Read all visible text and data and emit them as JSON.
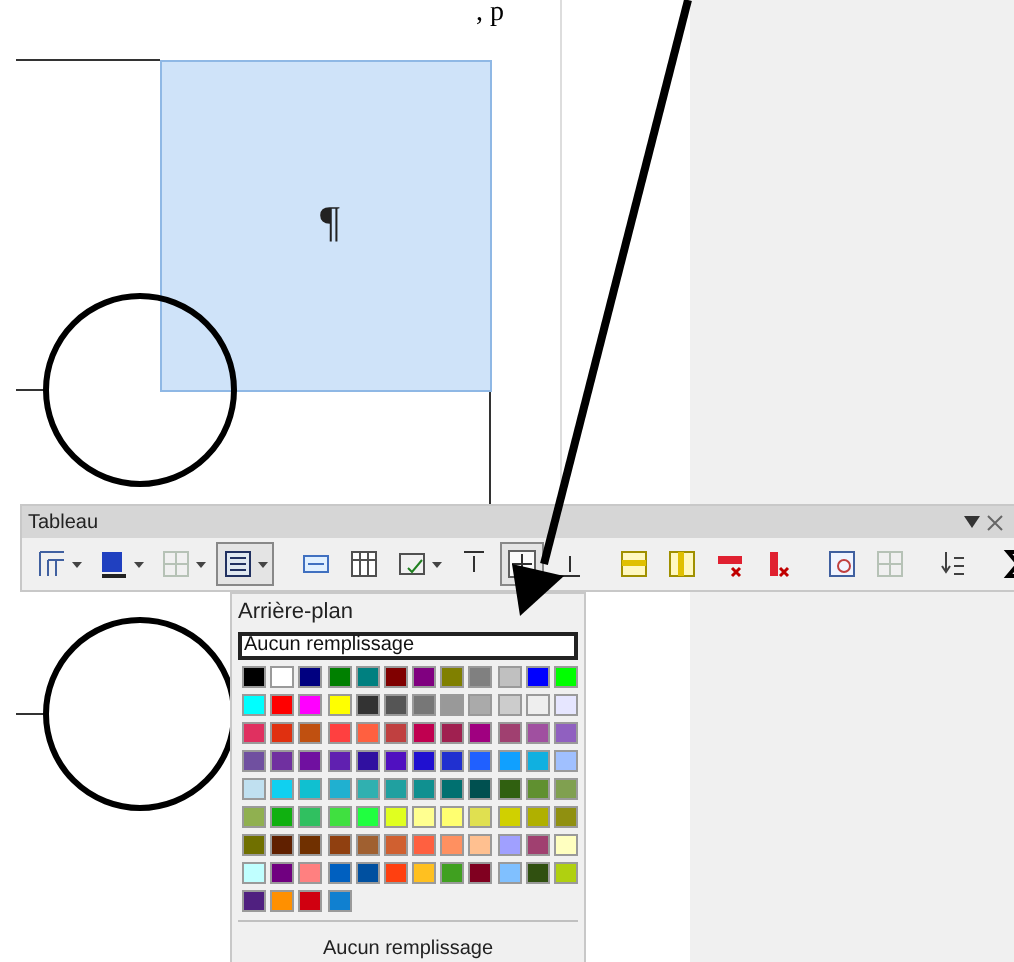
{
  "document": {
    "top_text": ", p",
    "paragraph_mark": "¶"
  },
  "toolbar": {
    "title": "Tableau",
    "buttons": [
      {
        "kind": "borders",
        "pressed": false,
        "dropdown": true
      },
      {
        "kind": "border-style",
        "pressed": false,
        "dropdown": true
      },
      {
        "kind": "merge",
        "pressed": false,
        "dropdown": true,
        "disabled": true
      },
      {
        "kind": "background",
        "pressed": true,
        "dropdown": true
      },
      {
        "kind": "sep"
      },
      {
        "kind": "split-row",
        "pressed": false,
        "dropdown": false
      },
      {
        "kind": "table",
        "pressed": false,
        "dropdown": false
      },
      {
        "kind": "autoformat",
        "pressed": false,
        "dropdown": true
      },
      {
        "kind": "align-top",
        "pressed": false,
        "dropdown": false
      },
      {
        "kind": "align-middle",
        "pressed": true,
        "dropdown": false
      },
      {
        "kind": "align-bottom",
        "pressed": false,
        "dropdown": false
      },
      {
        "kind": "sep"
      },
      {
        "kind": "insert-row",
        "pressed": false,
        "dropdown": false
      },
      {
        "kind": "insert-col",
        "pressed": false,
        "dropdown": false
      },
      {
        "kind": "delete-row",
        "pressed": false,
        "dropdown": false
      },
      {
        "kind": "delete-col",
        "pressed": false,
        "dropdown": false
      },
      {
        "kind": "sep"
      },
      {
        "kind": "select-table",
        "pressed": false,
        "dropdown": false
      },
      {
        "kind": "properties",
        "pressed": false,
        "dropdown": false,
        "disabled": true
      },
      {
        "kind": "sep"
      },
      {
        "kind": "sort",
        "pressed": false,
        "dropdown": false
      },
      {
        "kind": "sep"
      },
      {
        "kind": "sum",
        "pressed": false,
        "dropdown": false
      }
    ]
  },
  "popup": {
    "title": "Arrière-plan",
    "field": "Aucun remplissage",
    "footer": "Aucun remplissage",
    "swatches": [
      {
        "color": "#000000"
      },
      {
        "color": "#ffffff"
      },
      {
        "color": "#000080"
      },
      {
        "color": "#008000"
      },
      {
        "color": "#008080"
      },
      {
        "color": "#800000"
      },
      {
        "color": "#800080"
      },
      {
        "color": "#808000"
      },
      {
        "color": "#808080"
      },
      {
        "color": "#c0c0c0"
      },
      {
        "color": "#0000ff"
      },
      {
        "color": "#00ff00"
      },
      {
        "color": "#00ffff"
      },
      {
        "color": "#ff0000"
      },
      {
        "color": "#ff00ff"
      },
      {
        "color": "#ffff00"
      },
      {
        "color": "#333333"
      },
      {
        "color": "#555555"
      },
      {
        "color": "#777777"
      },
      {
        "color": "#999999"
      },
      {
        "color": "#aaaaaa"
      },
      {
        "color": "#cccccc"
      },
      {
        "color": "#eeeeee"
      },
      {
        "color": "#e6e6ff"
      },
      {
        "color": "#e03060"
      },
      {
        "color": "#e03010"
      },
      {
        "color": "#c05010"
      },
      {
        "color": "#ff4040"
      },
      {
        "color": "#ff6040"
      },
      {
        "color": "#c04040"
      },
      {
        "color": "#c00050"
      },
      {
        "color": "#a02050"
      },
      {
        "color": "#a00080"
      },
      {
        "color": "#a04070"
      },
      {
        "color": "#a050a0"
      },
      {
        "color": "#9060c0"
      },
      {
        "color": "#7050a0"
      },
      {
        "color": "#7030a0"
      },
      {
        "color": "#7010a0"
      },
      {
        "color": "#6020b0"
      },
      {
        "color": "#3010a0"
      },
      {
        "color": "#5010c0"
      },
      {
        "color": "#2010d0"
      },
      {
        "color": "#2030d0"
      },
      {
        "color": "#2060ff"
      },
      {
        "color": "#10a0ff"
      },
      {
        "color": "#10b0e0"
      },
      {
        "color": "#a0c0ff"
      },
      {
        "color": "#c0e0f0"
      },
      {
        "color": "#10d0f0"
      },
      {
        "color": "#10c0d0"
      },
      {
        "color": "#20b0d0"
      },
      {
        "color": "#30b0b0"
      },
      {
        "color": "#20a0a0"
      },
      {
        "color": "#109090"
      },
      {
        "color": "#007070"
      },
      {
        "color": "#005050"
      },
      {
        "color": "#306010"
      },
      {
        "color": "#609030"
      },
      {
        "color": "#80a050"
      },
      {
        "color": "#90b050"
      },
      {
        "color": "#10b010"
      },
      {
        "color": "#30c060"
      },
      {
        "color": "#40e040"
      },
      {
        "color": "#20ff40"
      },
      {
        "color": "#e0ff20"
      },
      {
        "color": "#ffff90"
      },
      {
        "color": "#ffff70"
      },
      {
        "color": "#e0e050"
      },
      {
        "color": "#d0d000"
      },
      {
        "color": "#b0b000"
      },
      {
        "color": "#909010"
      },
      {
        "color": "#707000"
      },
      {
        "color": "#602000"
      },
      {
        "color": "#703000"
      },
      {
        "color": "#904010"
      },
      {
        "color": "#a06030"
      },
      {
        "color": "#d06030"
      },
      {
        "color": "#ff6040"
      },
      {
        "color": "#ff9060"
      },
      {
        "color": "#ffc090"
      },
      {
        "color": "#a0a0ff"
      },
      {
        "color": "#a04070"
      },
      {
        "color": "#ffffc0"
      },
      {
        "color": "#c0ffff"
      },
      {
        "color": "#700080"
      },
      {
        "color": "#ff8080"
      },
      {
        "color": "#0060c0"
      },
      {
        "color": "#0050a0"
      },
      {
        "color": "#ff4010"
      },
      {
        "color": "#ffc020"
      },
      {
        "color": "#40a020"
      },
      {
        "color": "#800020"
      },
      {
        "color": "#80c0ff"
      },
      {
        "color": "#305010"
      },
      {
        "color": "#b0d010"
      },
      {
        "color": "#502080"
      },
      {
        "color": "#ff9000"
      },
      {
        "color": "#d00010"
      },
      {
        "color": "#1080d0"
      }
    ]
  }
}
